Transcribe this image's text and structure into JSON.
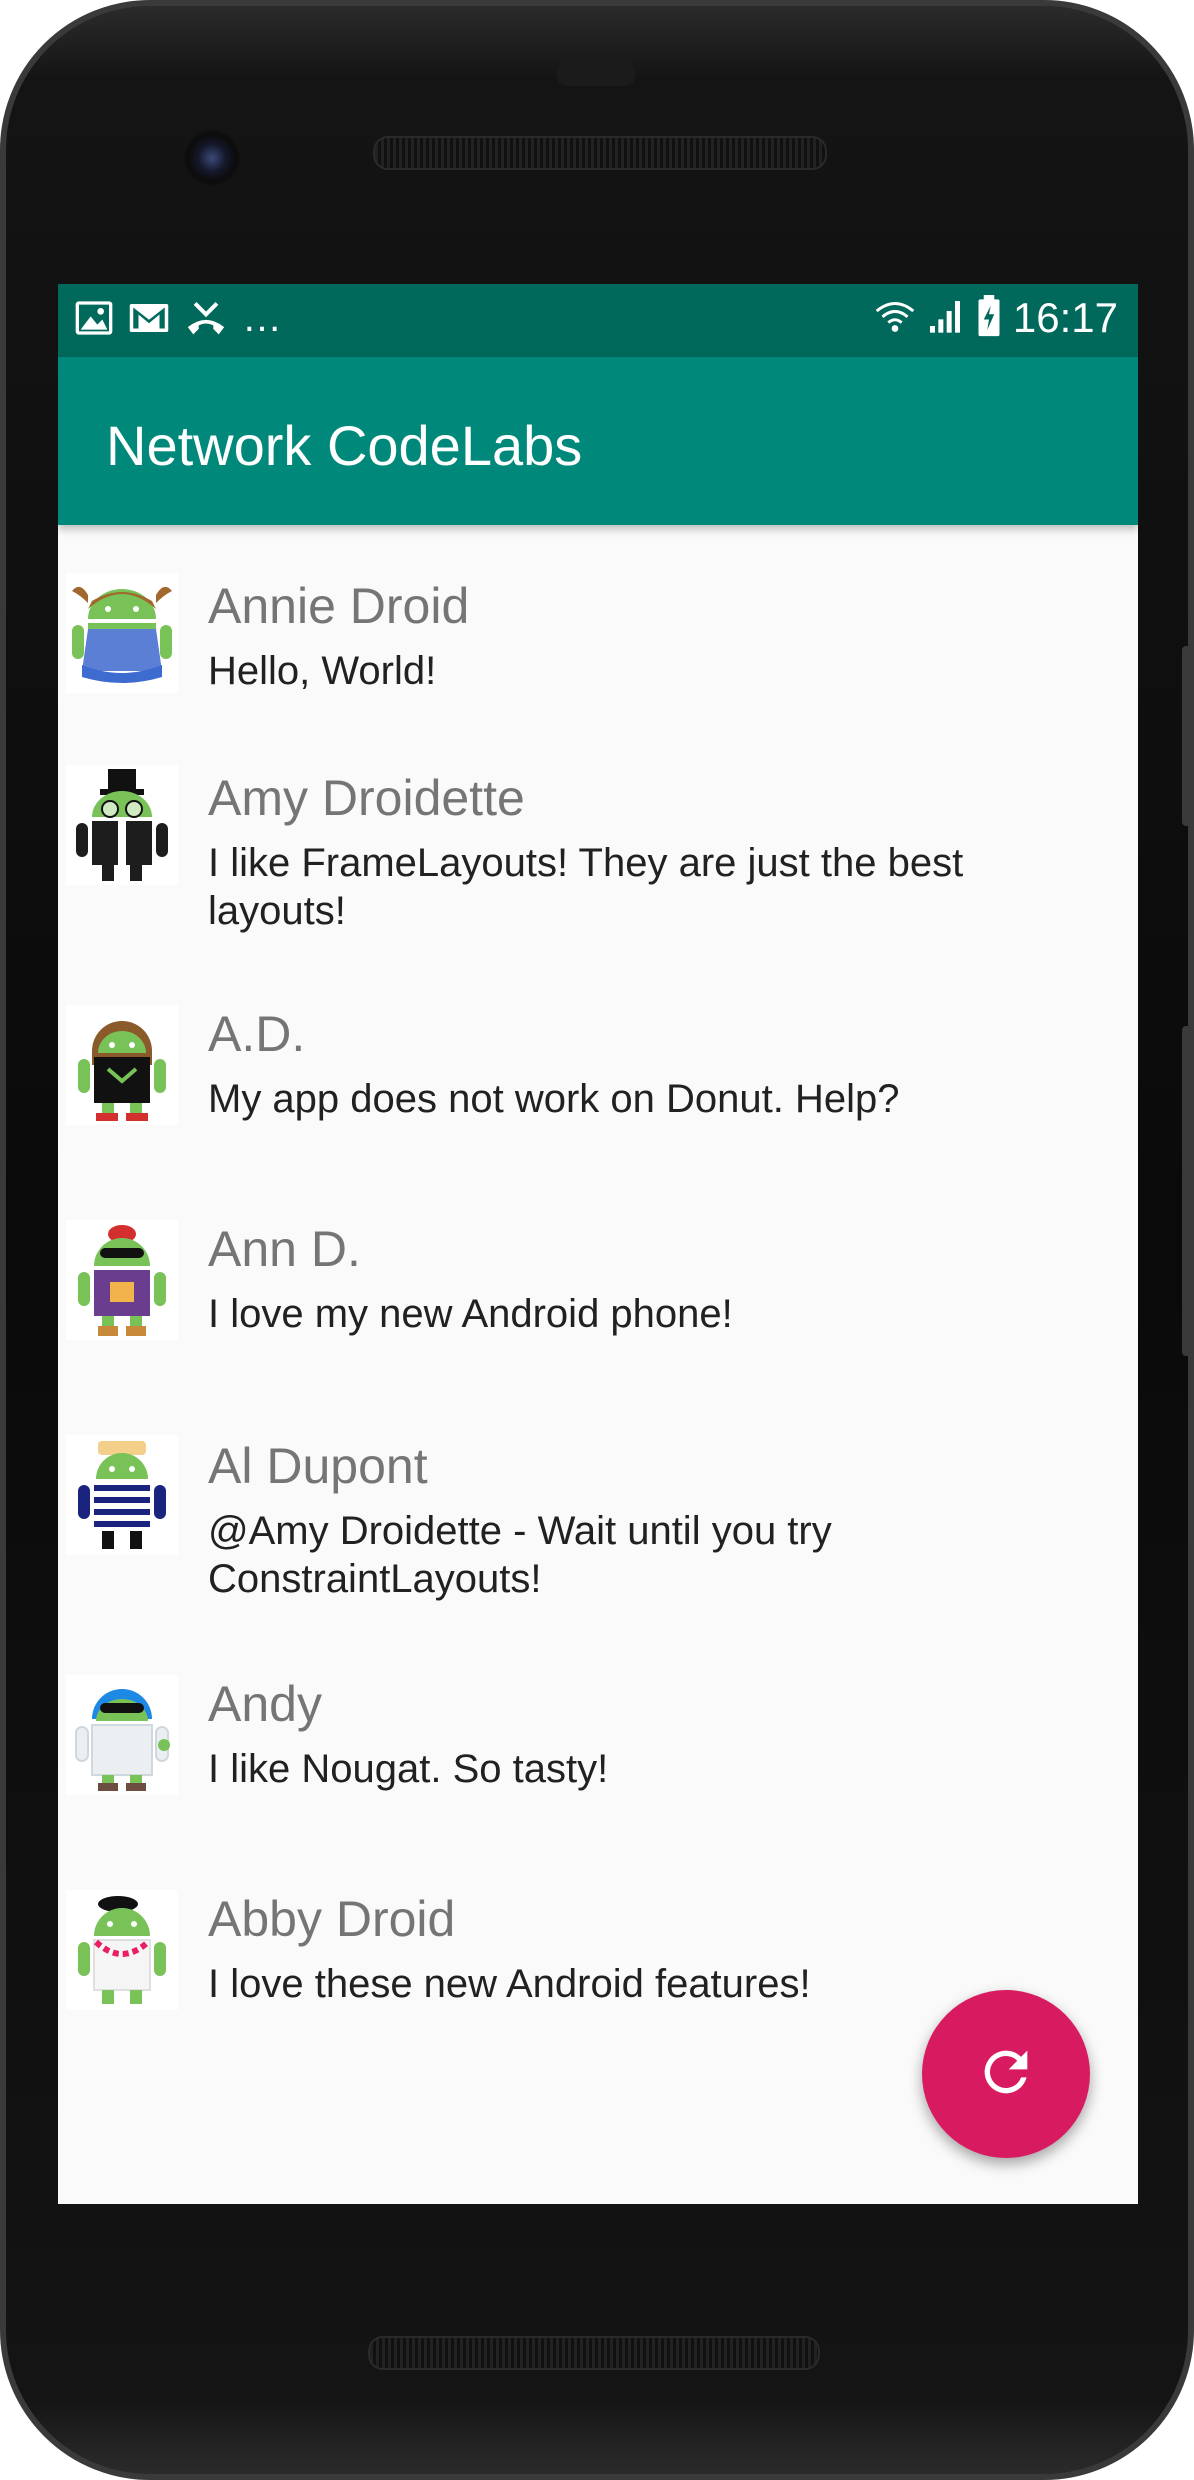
{
  "status_bar": {
    "time": "16:17",
    "more_indicator": "…",
    "left_icons": [
      "image-icon",
      "gmail-icon",
      "missed-call-icon"
    ],
    "right_icons": [
      "wifi-icon",
      "signal-icon",
      "battery-charging-icon"
    ]
  },
  "app_bar": {
    "title": "Network CodeLabs"
  },
  "messages": [
    {
      "name": "Annie Droid",
      "text": "Hello, World!",
      "avatar": "android-avatar-ponytails"
    },
    {
      "name": "Amy Droidette",
      "text": "I like FrameLayouts! They are just the best layouts!",
      "avatar": "android-avatar-top-hat"
    },
    {
      "name": "A.D.",
      "text": "My app does not work on Donut. Help?",
      "avatar": "android-avatar-brown-hair"
    },
    {
      "name": "Ann D.",
      "text": "I love my new Android phone!",
      "avatar": "android-avatar-sunglasses"
    },
    {
      "name": "Al Dupont",
      "text": "@Amy Droidette - Wait until you try ConstraintLayouts!",
      "avatar": "android-avatar-striped-shirt"
    },
    {
      "name": "Andy",
      "text": "I like Nougat. So tasty!",
      "avatar": "android-avatar-lab-coat"
    },
    {
      "name": "Abby Droid",
      "text": "I love these new Android features!",
      "avatar": "android-avatar-beret"
    }
  ],
  "fab": {
    "icon": "refresh-icon"
  },
  "colors": {
    "status_bar": "#00695c",
    "app_bar": "#00897b",
    "fab": "#d81b60",
    "android_green": "#78c257"
  }
}
